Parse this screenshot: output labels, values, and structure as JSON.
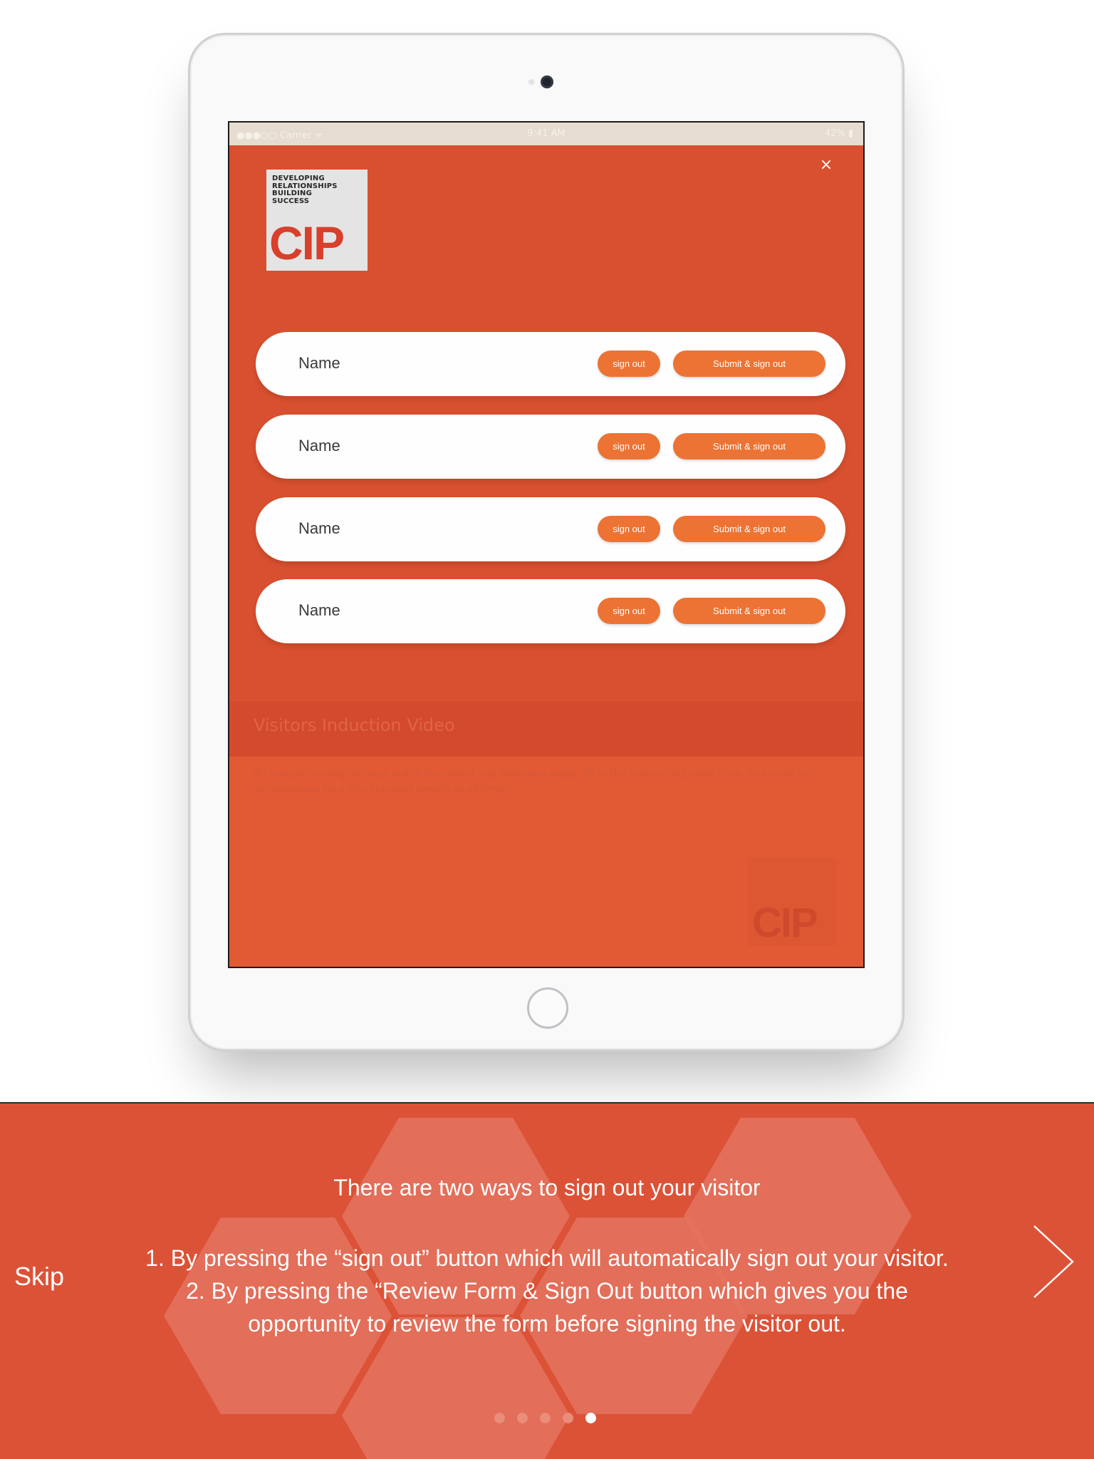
{
  "status_bar": {
    "carrier": "●●●○○ Carrier ᯤ",
    "time": "9:41 AM",
    "battery": "42% ▮"
  },
  "logo": {
    "tagline": [
      "DEVELOPING",
      "RELATIONSHIPS",
      "BUILDING",
      "SUCCESS"
    ],
    "mark": "CIP"
  },
  "rows": [
    {
      "name": "Name",
      "sign_out": "sign out",
      "submit": "Submit & sign out"
    },
    {
      "name": "Name",
      "sign_out": "sign out",
      "submit": "Submit & sign out"
    },
    {
      "name": "Name",
      "sign_out": "sign out",
      "submit": "Submit & sign out"
    },
    {
      "name": "Name",
      "sign_out": "sign out",
      "submit": "Submit & sign out"
    }
  ],
  "background_screen": {
    "title": "Visitors Induction Video",
    "body": "All visitors coming on must watch the visitor site induction video, fill in the visitors induction form, and must be accompanied by a site inducted person at all times."
  },
  "close_icon": "×",
  "tutorial": {
    "title": "There are two ways to sign out your visitor",
    "line1": "1. By pressing the “sign out” button which will automatically sign out your visitor.",
    "line2": "2. By pressing the “Review Form & Sign Out button which gives you the opportunity to review the form before signing the visitor out.",
    "skip_label": "Skip",
    "next_icon": "chevron-right-icon",
    "page_count": 5,
    "current_page": 5
  },
  "colors": {
    "accent": "#dc5237",
    "button": "#ec7333",
    "screen_bg": "#d8502f"
  }
}
